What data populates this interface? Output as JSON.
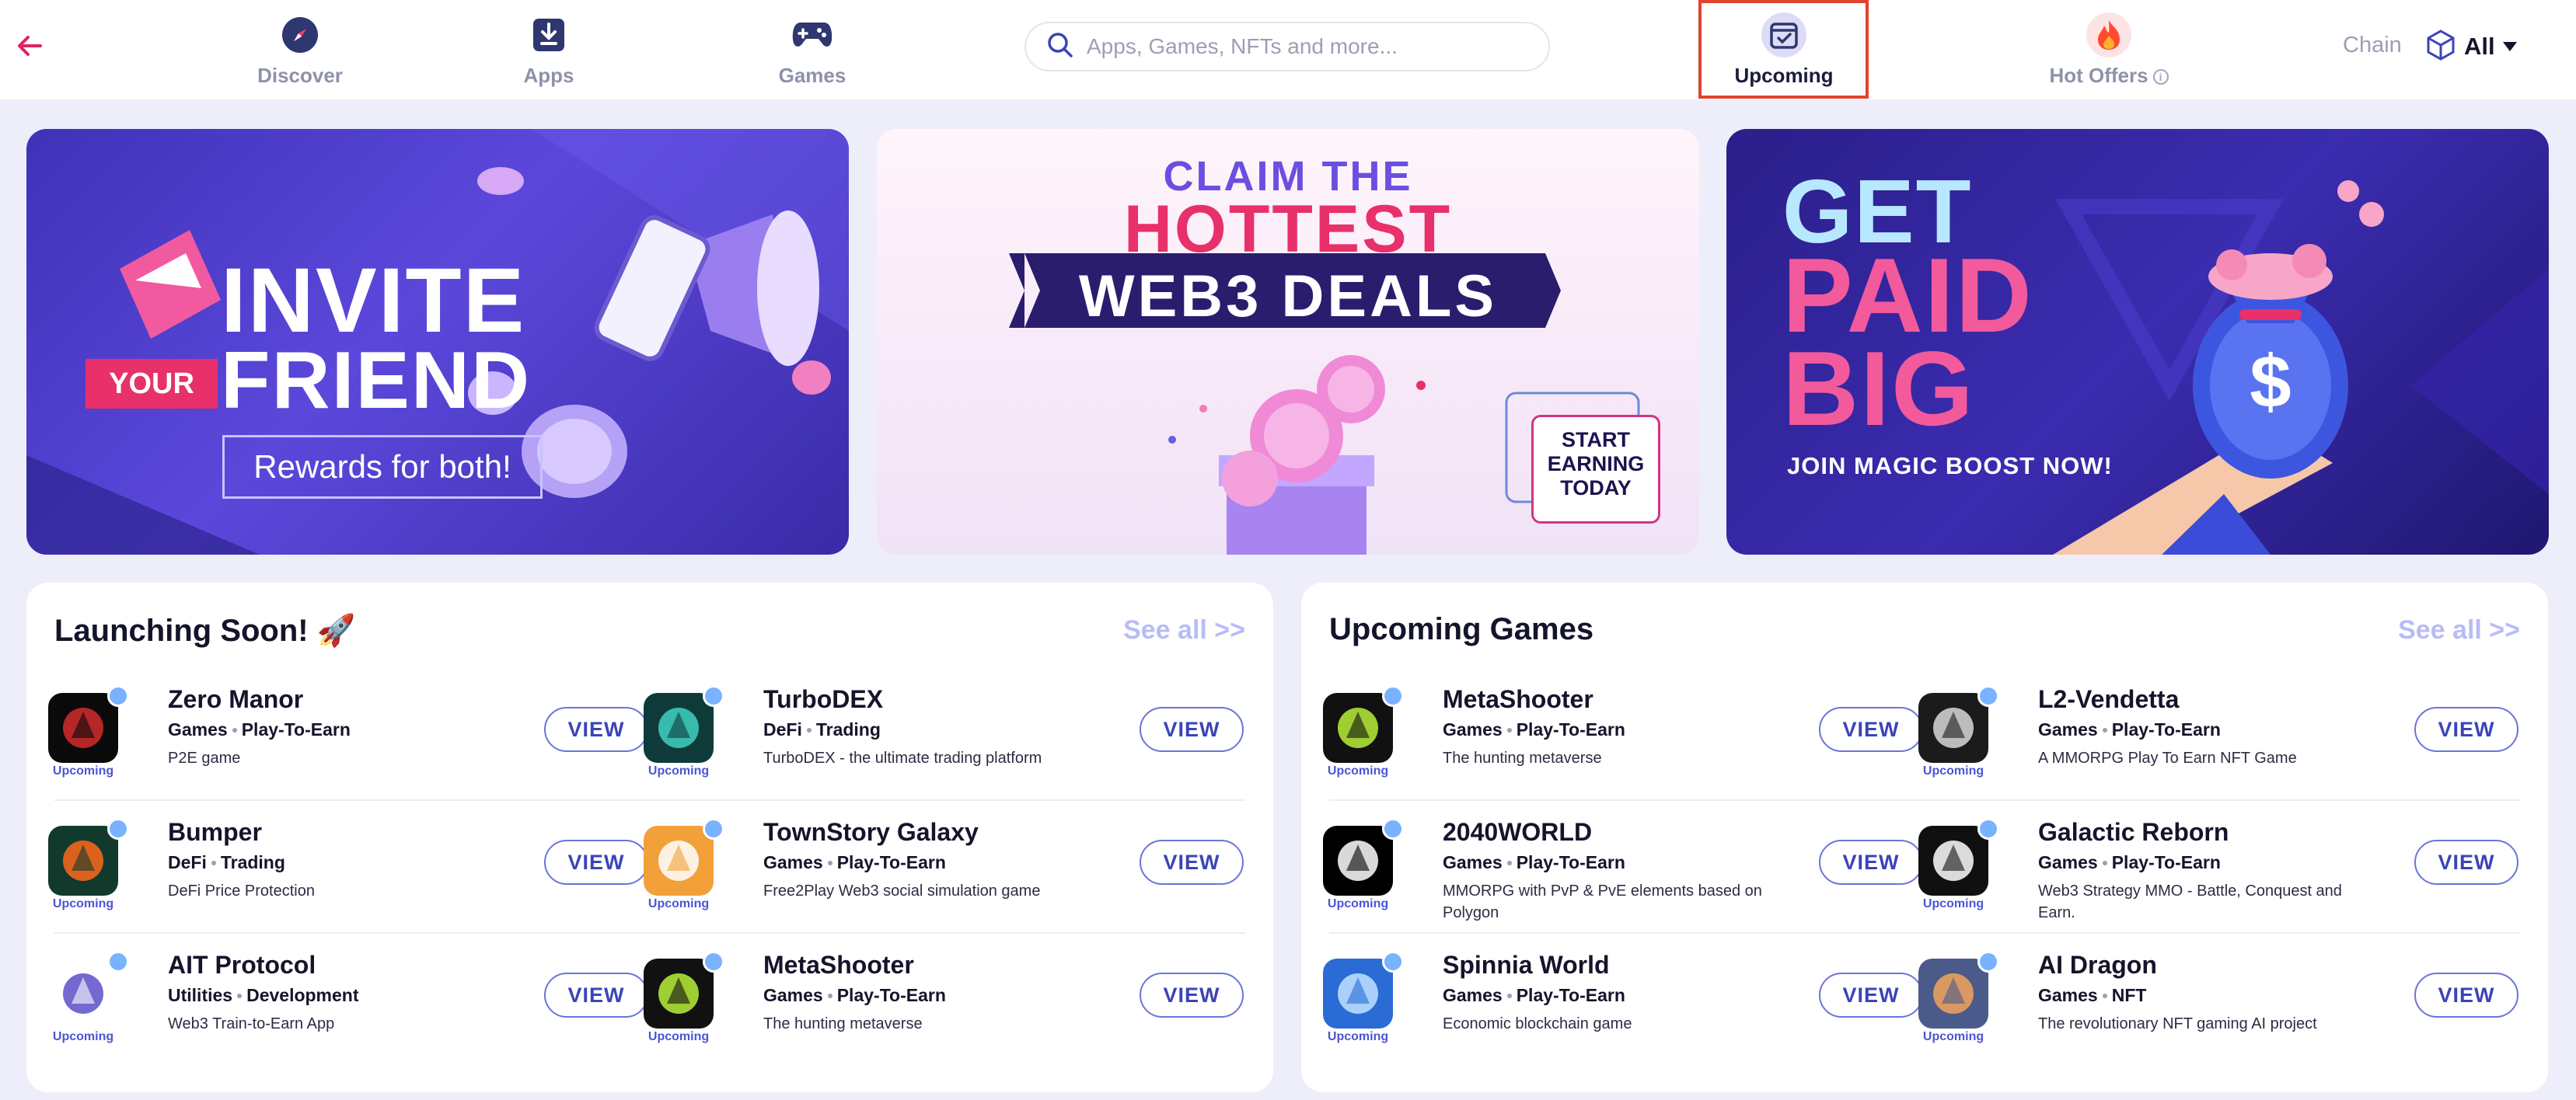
{
  "nav": {
    "items": [
      {
        "label": "Discover",
        "icon": "compass-icon"
      },
      {
        "label": "Apps",
        "icon": "download-box-icon"
      },
      {
        "label": "Games",
        "icon": "gamepad-icon"
      },
      {
        "label": "Upcoming",
        "icon": "calendar-check-icon"
      },
      {
        "label": "Hot Offers",
        "icon": "fire-icon"
      }
    ],
    "active": "Upcoming"
  },
  "search": {
    "placeholder": "Apps, Games, NFTs and more..."
  },
  "chain": {
    "label": "Chain",
    "value": "All"
  },
  "banners": {
    "invite": {
      "your": "YOUR",
      "invite": "INVITE",
      "friend": "FRIEND",
      "rewards": "Rewards for both!"
    },
    "deals": {
      "claim": "CLAIM THE",
      "hottest": "HOTTEST",
      "web3": "WEB3 DEALS",
      "start": "START",
      "earning": "EARNING",
      "today": "TODAY"
    },
    "paid": {
      "get": "GET",
      "paid": "PAID",
      "big": "BIG",
      "join": "JOIN MAGIC BOOST NOW!"
    }
  },
  "sections": [
    {
      "title": "Launching Soon! 🚀",
      "see_all": "See all >>",
      "apps": [
        {
          "name": "Zero Manor",
          "cat1": "Games",
          "cat2": "Play-To-Earn",
          "desc": "P2E game",
          "status": "Upcoming",
          "button": "VIEW",
          "logo_bg": "#0a0a0a",
          "logo_fg": "#d42b2b"
        },
        {
          "name": "TurboDEX",
          "cat1": "DeFi",
          "cat2": "Trading",
          "desc": "TurboDEX - the ultimate trading platform",
          "status": "Upcoming",
          "button": "VIEW",
          "logo_bg": "#0e3b3a",
          "logo_fg": "#3fd1c2"
        },
        {
          "name": "Bumper",
          "cat1": "DeFi",
          "cat2": "Trading",
          "desc": "DeFi Price Protection",
          "status": "Upcoming",
          "button": "VIEW",
          "logo_bg": "#123a2c",
          "logo_fg": "#ff6a1a"
        },
        {
          "name": "TownStory Galaxy",
          "cat1": "Games",
          "cat2": "Play-To-Earn",
          "desc": "Free2Play Web3 social simulation game",
          "status": "Upcoming",
          "button": "VIEW",
          "logo_bg": "#f2a03a",
          "logo_fg": "#ffffff"
        },
        {
          "name": "AIT Protocol",
          "cat1": "Utilities",
          "cat2": "Development",
          "desc": "Web3 Train-to-Earn App",
          "status": "Upcoming",
          "button": "VIEW",
          "logo_bg": "#ffffff",
          "logo_fg": "#5a4fc7"
        },
        {
          "name": "MetaShooter",
          "cat1": "Games",
          "cat2": "Play-To-Earn",
          "desc": "The hunting metaverse",
          "status": "Upcoming",
          "button": "VIEW",
          "logo_bg": "#111111",
          "logo_fg": "#b9f03a"
        }
      ]
    },
    {
      "title": "Upcoming Games",
      "see_all": "See all >>",
      "apps": [
        {
          "name": "MetaShooter",
          "cat1": "Games",
          "cat2": "Play-To-Earn",
          "desc": "The hunting metaverse",
          "status": "Upcoming",
          "button": "VIEW",
          "logo_bg": "#111111",
          "logo_fg": "#b9f03a"
        },
        {
          "name": "L2-Vendetta",
          "cat1": "Games",
          "cat2": "Play-To-Earn",
          "desc": "A MMORPG Play To Earn NFT Game",
          "status": "Upcoming",
          "button": "VIEW",
          "logo_bg": "#1b1b1b",
          "logo_fg": "#d8d8d8"
        },
        {
          "name": "2040WORLD",
          "cat1": "Games",
          "cat2": "Play-To-Earn",
          "desc": "MMORPG with PvP & PvE elements based on Polygon",
          "status": "Upcoming",
          "button": "VIEW",
          "logo_bg": "#000000",
          "logo_fg": "#ffffff"
        },
        {
          "name": "Galactic Reborn",
          "cat1": "Games",
          "cat2": "Play-To-Earn",
          "desc": "Web3 Strategy MMO - Battle, Conquest and Earn.",
          "status": "Upcoming",
          "button": "VIEW",
          "logo_bg": "#101010",
          "logo_fg": "#ffffff"
        },
        {
          "name": "Spinnia World",
          "cat1": "Games",
          "cat2": "Play-To-Earn",
          "desc": "Economic blockchain game",
          "status": "Upcoming",
          "button": "VIEW",
          "logo_bg": "#2a6bd6",
          "logo_fg": "#bfe3ff"
        },
        {
          "name": "AI Dragon",
          "cat1": "Games",
          "cat2": "NFT",
          "desc": "The revolutionary NFT gaming AI project",
          "status": "Upcoming",
          "button": "VIEW",
          "logo_bg": "#4a5a8a",
          "logo_fg": "#f3a35a"
        }
      ]
    }
  ],
  "colors": {
    "accent": "#3b44b8",
    "active_box": "#e0432d",
    "back_arrow": "#e0245e",
    "see_all": "#b8bcf5"
  }
}
